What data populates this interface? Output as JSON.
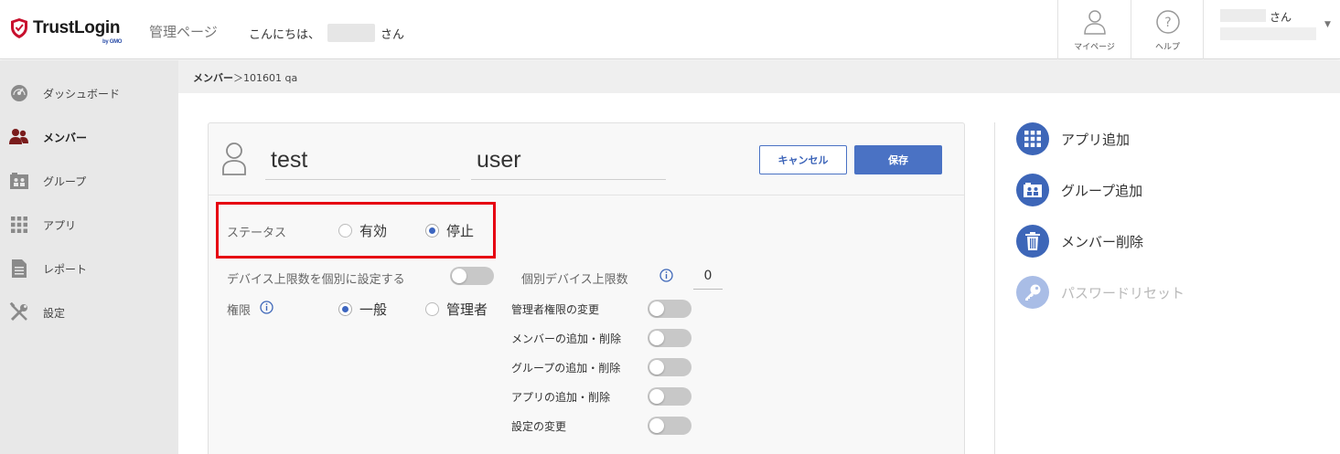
{
  "header": {
    "logo_text": "TrustLogin",
    "logo_sub": "by GMO",
    "admin_label": "管理ページ",
    "greeting_prefix": "こんにちは、",
    "greeting_suffix": "さん",
    "mypage_label": "マイページ",
    "help_label": "ヘルプ",
    "user_suffix": "さん"
  },
  "sidebar": {
    "items": [
      {
        "label": "ダッシュボード",
        "icon": "dashboard-icon"
      },
      {
        "label": "メンバー",
        "icon": "members-icon",
        "active": true
      },
      {
        "label": "グループ",
        "icon": "group-icon"
      },
      {
        "label": "アプリ",
        "icon": "apps-grid-icon"
      },
      {
        "label": "レポート",
        "icon": "report-icon"
      },
      {
        "label": "設定",
        "icon": "settings-tools-icon"
      }
    ]
  },
  "breadcrumb": {
    "parent": "メンバー",
    "separator": "＞",
    "current": "101601 qa"
  },
  "form": {
    "first_name": "test",
    "last_name": "user",
    "cancel_label": "キャンセル",
    "save_label": "保存",
    "status_label": "ステータス",
    "status_options": [
      "有効",
      "停止"
    ],
    "status_selected": "停止",
    "device_limit_label": "デバイス上限数を個別に設定する",
    "device_limit_toggle": false,
    "individual_device_label": "個別デバイス上限数",
    "individual_device_value": "0",
    "role_label": "権限",
    "role_options": [
      "一般",
      "管理者"
    ],
    "role_selected": "一般",
    "permissions": [
      {
        "label": "管理者権限の変更",
        "enabled": false
      },
      {
        "label": "メンバーの追加・削除",
        "enabled": false
      },
      {
        "label": "グループの追加・削除",
        "enabled": false
      },
      {
        "label": "アプリの追加・削除",
        "enabled": false
      },
      {
        "label": "設定の変更",
        "enabled": false
      }
    ]
  },
  "actions": [
    {
      "label": "アプリ追加",
      "icon": "apps-grid-icon",
      "enabled": true
    },
    {
      "label": "グループ追加",
      "icon": "group-add-icon",
      "enabled": true
    },
    {
      "label": "メンバー削除",
      "icon": "trash-icon",
      "enabled": true
    },
    {
      "label": "パスワードリセット",
      "icon": "key-icon",
      "enabled": false
    }
  ],
  "colors": {
    "accent": "#3d66b8",
    "highlight_border": "#e60012",
    "sidebar_bg": "#e8e8e8"
  }
}
